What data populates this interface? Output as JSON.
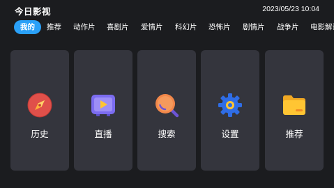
{
  "header": {
    "title": "今日影视",
    "datetime": "2023/05/23 10:04"
  },
  "tabs": [
    {
      "label": "我的",
      "active": true
    },
    {
      "label": "推荐",
      "active": false
    },
    {
      "label": "动作片",
      "active": false
    },
    {
      "label": "喜剧片",
      "active": false
    },
    {
      "label": "爱情片",
      "active": false
    },
    {
      "label": "科幻片",
      "active": false
    },
    {
      "label": "恐怖片",
      "active": false
    },
    {
      "label": "剧情片",
      "active": false
    },
    {
      "label": "战争片",
      "active": false
    },
    {
      "label": "电影解说",
      "active": false
    }
  ],
  "cards": [
    {
      "label": "历史",
      "icon": "compass-icon"
    },
    {
      "label": "直播",
      "icon": "tv-play-icon"
    },
    {
      "label": "搜索",
      "icon": "search-icon"
    },
    {
      "label": "设置",
      "icon": "gear-icon"
    },
    {
      "label": "推荐",
      "icon": "folder-icon"
    }
  ],
  "colors": {
    "background": "#1b1c1f",
    "card": "#34353d",
    "accent": "#2aa0f7"
  }
}
